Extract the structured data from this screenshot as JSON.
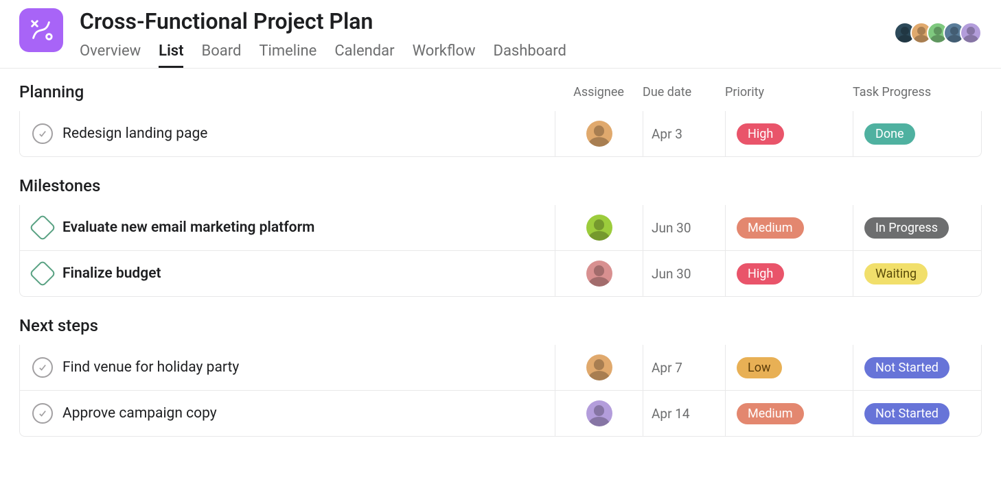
{
  "project": {
    "title": "Cross-Functional Project Plan"
  },
  "tabs": [
    {
      "label": "Overview",
      "active": false
    },
    {
      "label": "List",
      "active": true
    },
    {
      "label": "Board",
      "active": false
    },
    {
      "label": "Timeline",
      "active": false
    },
    {
      "label": "Calendar",
      "active": false
    },
    {
      "label": "Workflow",
      "active": false
    },
    {
      "label": "Dashboard",
      "active": false
    }
  ],
  "collaborators": [
    {
      "color": "#2d4a5a"
    },
    {
      "color": "#e0a96d"
    },
    {
      "color": "#7fc97f"
    },
    {
      "color": "#5a7d9a"
    },
    {
      "color": "#b39ddb"
    }
  ],
  "columns": {
    "assignee": "Assignee",
    "due": "Due date",
    "priority": "Priority",
    "progress": "Task Progress"
  },
  "sections": [
    {
      "title": "Planning",
      "showColumns": true,
      "tasks": [
        {
          "icon": "check",
          "bold": false,
          "name": "Redesign landing page",
          "assigneeColor": "#e0a96d",
          "due": "Apr 3",
          "priority": "High",
          "progress": "Done"
        }
      ]
    },
    {
      "title": "Milestones",
      "showColumns": false,
      "tasks": [
        {
          "icon": "milestone",
          "bold": true,
          "name": "Evaluate new email marketing platform",
          "assigneeColor": "#9ccc3c",
          "due": "Jun 30",
          "priority": "Medium",
          "progress": "In Progress"
        },
        {
          "icon": "milestone",
          "bold": true,
          "name": "Finalize budget",
          "assigneeColor": "#d89090",
          "due": "Jun 30",
          "priority": "High",
          "progress": "Waiting"
        }
      ]
    },
    {
      "title": "Next steps",
      "showColumns": false,
      "tasks": [
        {
          "icon": "check",
          "bold": false,
          "name": "Find venue for holiday party",
          "assigneeColor": "#e0a96d",
          "due": "Apr 7",
          "priority": "Low",
          "progress": "Not Started"
        },
        {
          "icon": "check",
          "bold": false,
          "name": "Approve campaign copy",
          "assigneeColor": "#b39ddb",
          "due": "Apr 14",
          "priority": "Medium",
          "progress": "Not Started"
        }
      ]
    }
  ]
}
